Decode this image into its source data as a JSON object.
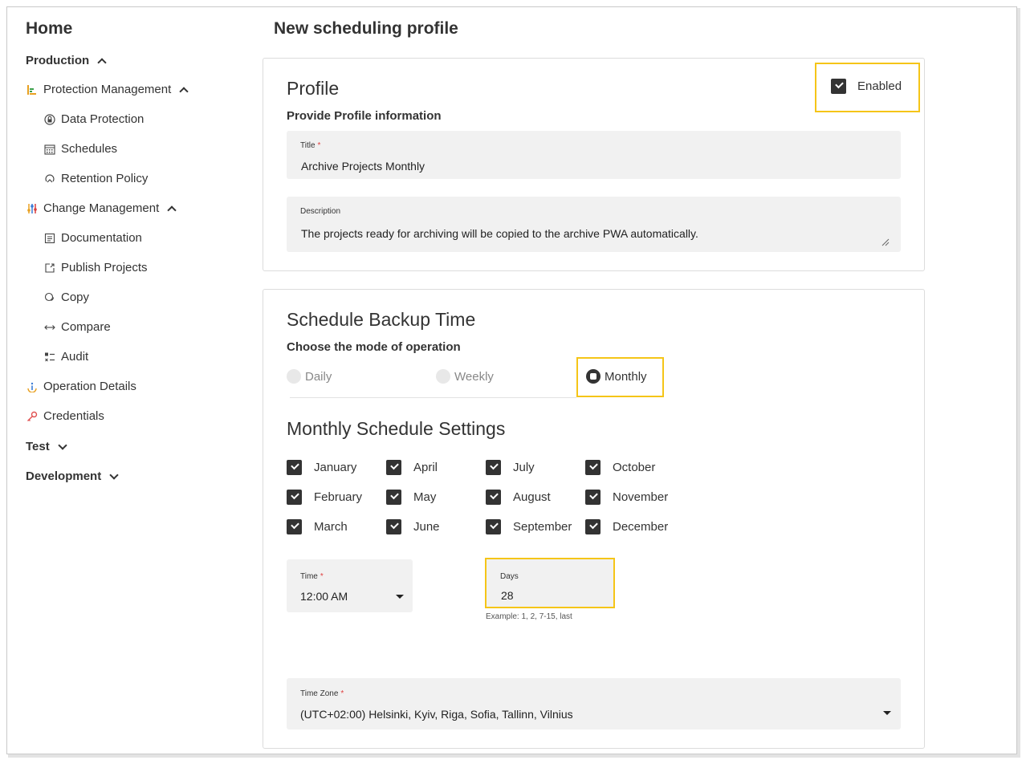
{
  "sidebar": {
    "home": "Home",
    "groups": [
      {
        "label": "Production"
      },
      {
        "label": "Test"
      },
      {
        "label": "Development"
      }
    ],
    "sections": [
      {
        "label": "Protection Management"
      },
      {
        "label": "Change Management"
      }
    ],
    "items": [
      {
        "label": "Data Protection",
        "icon": "lock-icon"
      },
      {
        "label": "Schedules",
        "icon": "calendar-icon"
      },
      {
        "label": "Retention Policy",
        "icon": "retention-icon"
      },
      {
        "label": "Documentation",
        "icon": "document-icon"
      },
      {
        "label": "Publish Projects",
        "icon": "publish-icon"
      },
      {
        "label": "Copy",
        "icon": "copy-icon"
      },
      {
        "label": "Compare",
        "icon": "compare-icon"
      },
      {
        "label": "Audit",
        "icon": "audit-icon"
      },
      {
        "label": "Operation Details",
        "icon": "info-icon"
      },
      {
        "label": "Credentials",
        "icon": "key-icon"
      }
    ]
  },
  "page": {
    "title": "New scheduling profile"
  },
  "profile": {
    "heading": "Profile",
    "subheading": "Provide Profile information",
    "enabled_label": "Enabled",
    "enabled": true,
    "title_label": "Title",
    "title_required": "*",
    "title_value": "Archive Projects Monthly",
    "description_label": "Description",
    "description_value": "The projects ready for archiving will be copied to the archive PWA automatically."
  },
  "schedule": {
    "heading": "Schedule Backup Time",
    "subheading": "Choose the mode of operation",
    "modes": [
      {
        "label": "Daily",
        "selected": false
      },
      {
        "label": "Weekly",
        "selected": false
      },
      {
        "label": "Monthly",
        "selected": true
      }
    ],
    "monthly_heading": "Monthly Schedule Settings",
    "months": [
      [
        "January",
        "April",
        "July",
        "October"
      ],
      [
        "February",
        "May",
        "August",
        "November"
      ],
      [
        "March",
        "June",
        "September",
        "December"
      ]
    ],
    "time_label": "Time",
    "time_required": "*",
    "time_value": "12:00 AM",
    "days_label": "Days",
    "days_value": "28",
    "days_hint": "Example: 1, 2, 7-15, last",
    "timezone_label": "Time Zone",
    "timezone_required": "*",
    "timezone_value": "(UTC+02:00) Helsinki, Kyiv, Riga, Sofia, Tallinn, Vilnius"
  },
  "colors": {
    "highlight": "#f5c518",
    "checkbox": "#333333",
    "field_bg": "#f1f1f1",
    "required": "#e04040"
  }
}
